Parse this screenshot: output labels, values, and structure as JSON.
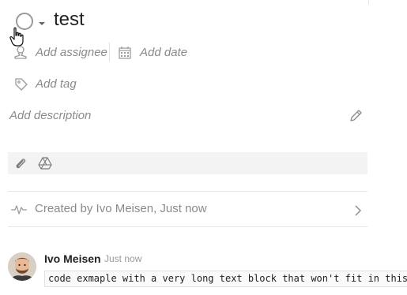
{
  "task": {
    "title": "test"
  },
  "meta": {
    "assignee_placeholder": "Add assignee",
    "date_placeholder": "Add date",
    "tag_placeholder": "Add tag",
    "description_placeholder": "Add description"
  },
  "activity": {
    "created_text": "Created by Ivo Meisen, Just now"
  },
  "comment": {
    "author": "Ivo Meisen",
    "time": "Just now",
    "code": "code exmaple with a very long text block that won't fit in this"
  },
  "icons": {
    "status": "status-circle-icon",
    "assignee": "person-icon",
    "date": "calendar-icon",
    "tag": "tag-icon",
    "edit": "pencil-icon",
    "attach": "paperclip-icon",
    "drive": "drive-icon",
    "activity": "pulse-icon",
    "expand": "chevron-right-icon"
  },
  "colors": {
    "muted_text": "#8a8a8a",
    "title_text": "#222222",
    "bar_background": "#f3f3f3"
  }
}
